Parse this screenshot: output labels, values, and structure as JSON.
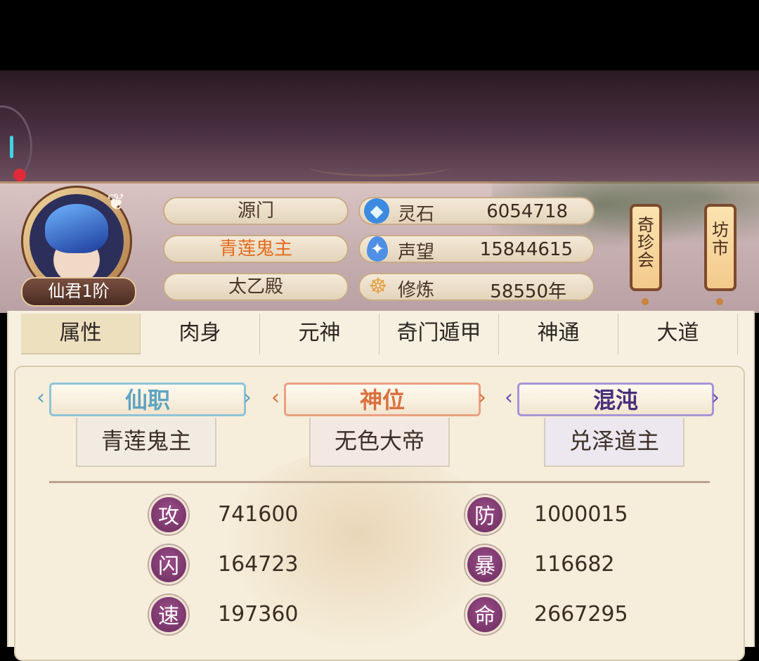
{
  "profile": {
    "rank": "仙君1阶"
  },
  "info_pills": [
    "源门",
    "青莲鬼主",
    "太乙殿"
  ],
  "resources": [
    {
      "name": "灵石",
      "value": "6054718",
      "icon": "gem-icon"
    },
    {
      "name": "声望",
      "value": "15844615",
      "icon": "crystal-icon"
    },
    {
      "name": "修炼",
      "value": "58550年",
      "icon": "meditation-icon"
    }
  ],
  "scrolls": [
    {
      "label": "奇珍会"
    },
    {
      "label": "坊市"
    }
  ],
  "tabs": [
    "属性",
    "肉身",
    "元神",
    "奇门遁甲",
    "神通",
    "大道"
  ],
  "active_tab": "属性",
  "titles": [
    {
      "header": "仙职",
      "value": "青莲鬼主",
      "color": "#5fa4c0"
    },
    {
      "header": "神位",
      "value": "无色大帝",
      "color": "#d9703f"
    },
    {
      "header": "混沌",
      "value": "兑泽道主",
      "color": "#6a4fb3"
    }
  ],
  "stats_left": [
    {
      "label": "攻",
      "value": "741600"
    },
    {
      "label": "闪",
      "value": "164723"
    },
    {
      "label": "速",
      "value": "197360"
    }
  ],
  "stats_right": [
    {
      "label": "防",
      "value": "1000015"
    },
    {
      "label": "暴",
      "value": "116682"
    },
    {
      "label": "命",
      "value": "2667295"
    }
  ],
  "colors": {
    "pill_highlight": "#e56a1c",
    "stat_badge": "#7d3a70"
  }
}
